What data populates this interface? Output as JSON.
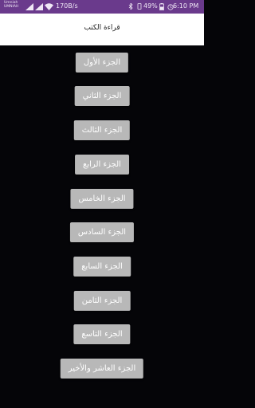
{
  "status_bar": {
    "carrier_line1": "Umniah",
    "carrier_line2": "UMNIAH",
    "net_speed": "170B/s",
    "battery_percent": "49%",
    "time": "6:10 PM",
    "background_color": "#6a3a8c"
  },
  "app_bar": {
    "title": "قراءة الكتب"
  },
  "parts": [
    {
      "label": "الجزء الأول"
    },
    {
      "label": "الجزء الثاني"
    },
    {
      "label": "الجزء الثالث"
    },
    {
      "label": "الجزء الرابع"
    },
    {
      "label": "الجزء الخامس"
    },
    {
      "label": "الجزء السادس"
    },
    {
      "label": "الجزء السابع"
    },
    {
      "label": "الجزء الثامن"
    },
    {
      "label": "الجزء التاسع"
    },
    {
      "label": "الجزء العاشر والأخير"
    }
  ],
  "theme": {
    "button_color": "#b8b8b8",
    "content_background": "#050508"
  }
}
